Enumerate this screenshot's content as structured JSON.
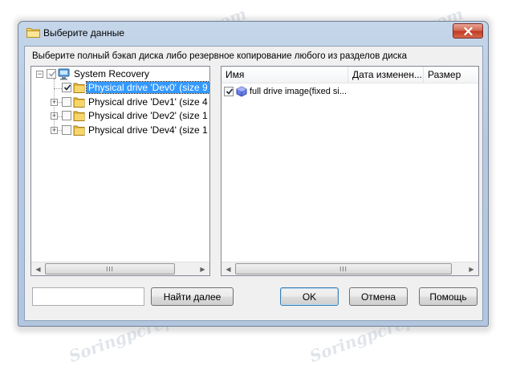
{
  "window": {
    "title": "Выберите данные",
    "description": "Выберите полный бэкап диска либо резервное копирование любого из разделов диска"
  },
  "tree": {
    "root": {
      "label": "System Recovery",
      "checked": "partial",
      "expanded": true
    },
    "items": [
      {
        "label": "Physical drive 'Dev0' (size 9",
        "checked": true,
        "selected": true,
        "expanded": false
      },
      {
        "label": "Physical drive 'Dev1' (size 4",
        "checked": false,
        "selected": false,
        "expanded": false
      },
      {
        "label": "Physical drive 'Dev2' (size 1",
        "checked": false,
        "selected": false,
        "expanded": false
      },
      {
        "label": "Physical drive 'Dev4' (size 1",
        "checked": false,
        "selected": false,
        "expanded": false
      }
    ]
  },
  "list": {
    "columns": [
      "Имя",
      "Дата изменен...",
      "Размер"
    ],
    "rows": [
      {
        "name": "full drive image(fixed si...",
        "checked": true
      }
    ]
  },
  "scrollbar": {
    "thumb_grip": "III",
    "left_arrow": "◀",
    "right_arrow": "▶"
  },
  "search": {
    "value": ""
  },
  "buttons": {
    "find_next": "Найти далее",
    "ok": "OK",
    "cancel": "Отмена",
    "help": "Помощь"
  },
  "watermark_text": "Soringpcrepair.com",
  "colors": {
    "selection": "#3399ff",
    "close_button": "#c9462c",
    "frame": "#b9cce3"
  }
}
